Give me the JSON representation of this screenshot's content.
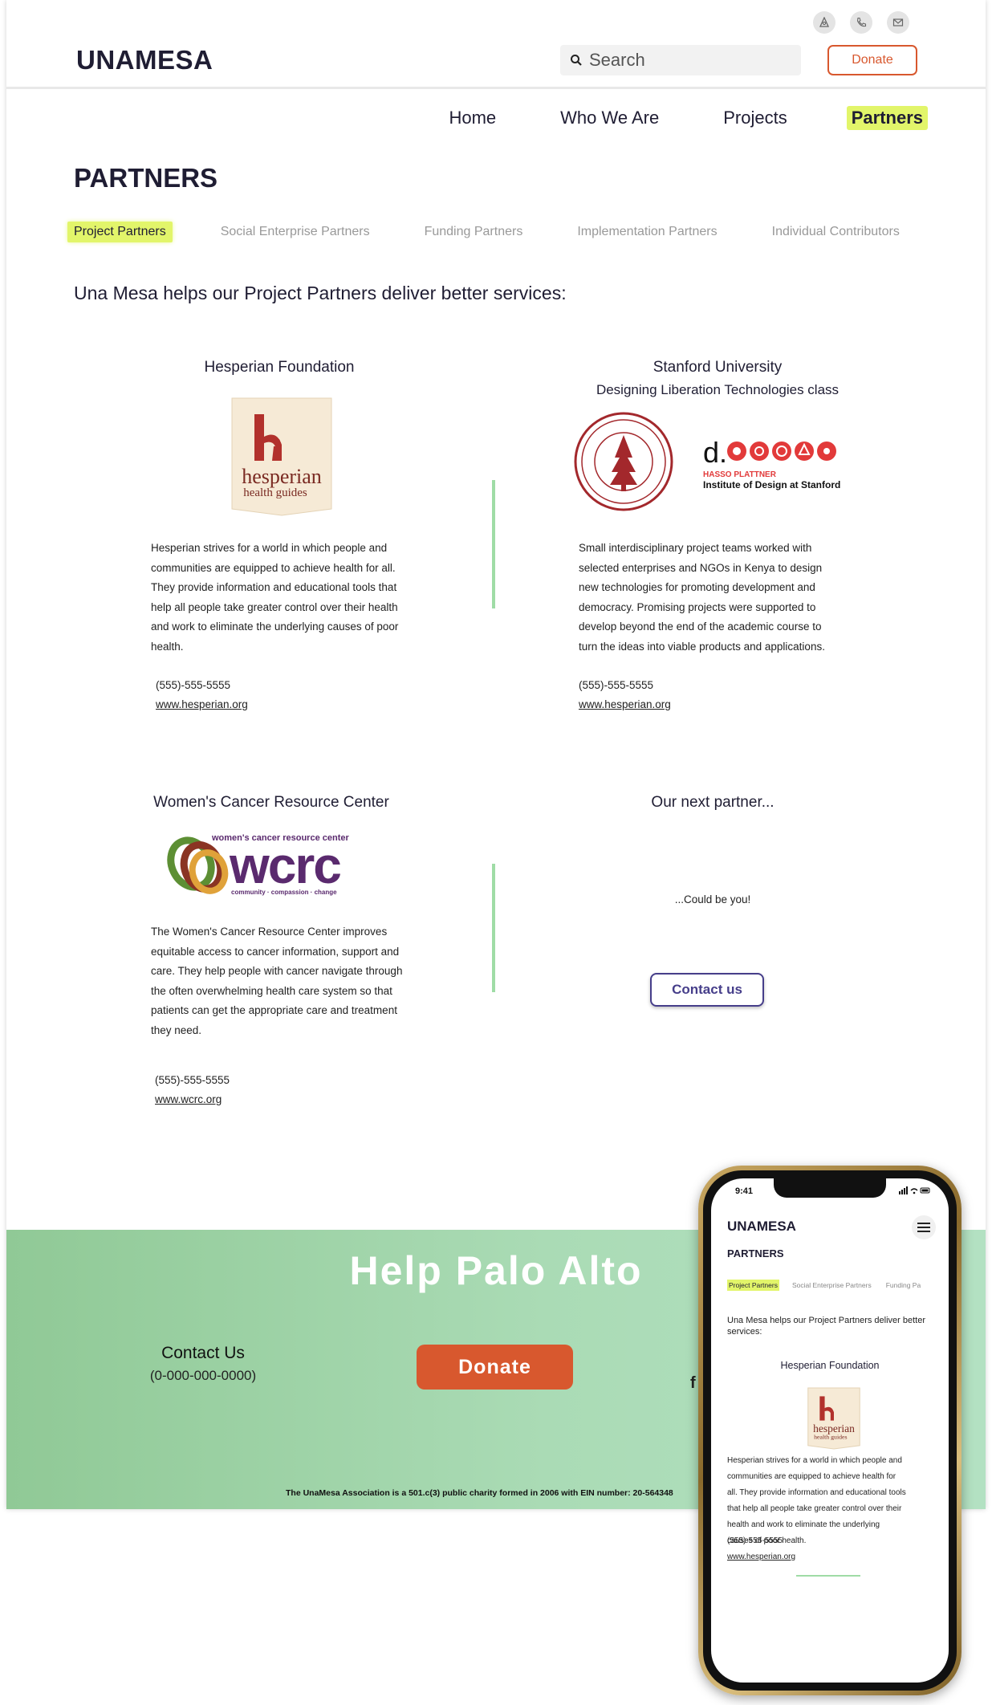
{
  "header": {
    "brand": "UNAMESA",
    "search_placeholder": "Search",
    "donate_label": "Donate",
    "icons": [
      "ambulance-icon",
      "phone-icon",
      "mail-icon"
    ]
  },
  "nav": {
    "items": [
      {
        "label": "Home"
      },
      {
        "label": "Who We Are"
      },
      {
        "label": "Projects"
      },
      {
        "label": "Partners"
      }
    ],
    "active": "Partners"
  },
  "page": {
    "title": "PARTNERS",
    "subtabs": [
      {
        "label": "Project Partners"
      },
      {
        "label": "Social Enterprise Partners"
      },
      {
        "label": "Funding Partners"
      },
      {
        "label": "Implementation Partners"
      },
      {
        "label": "Individual Contributors"
      }
    ],
    "intro": "Una Mesa helps our Project Partners deliver better services:"
  },
  "partners": [
    {
      "name": "Hesperian Foundation",
      "logo_text": [
        "hesperian",
        "health guides"
      ],
      "description": [
        "Hesperian strives for a world in which people and",
        "communities are equipped to achieve health for all.",
        "They provide information and educational tools that",
        "help all people take greater control over their health",
        "and work to eliminate the underlying causes of poor",
        "health."
      ],
      "phone": "(555)-555-5555",
      "url": "www.hesperian.org"
    },
    {
      "name": "Stanford University",
      "subtitle": "Designing Liberation Technologies class",
      "logo_text": [
        "d.",
        "HASSO PLATTNER",
        "Institute of Design at Stanford"
      ],
      "description": [
        "Small interdisciplinary project teams worked with",
        "selected enterprises and NGOs in Kenya to design",
        "new technologies for promoting development and",
        "democracy. Promising projects were supported to",
        "develop beyond the end of the academic course to",
        "turn the ideas into viable products and applications."
      ],
      "phone": "(555)-555-5555",
      "url": "www.hesperian.org"
    },
    {
      "name": "Women's Cancer Resource Center",
      "logo_text": [
        "women's cancer resource center",
        "wcrc",
        "community · compassion · change"
      ],
      "description": [
        "The Women's Cancer Resource Center improves",
        "equitable access to cancer information, support and",
        "care. They help people with cancer navigate through",
        "the often overwhelming health care system so that",
        "patients can get the appropriate care and treatment",
        "they need."
      ],
      "phone": "(555)-555-5555",
      "url": "www.wcrc.org"
    }
  ],
  "next_partner": {
    "title": "Our next partner...",
    "text": "...Could be you!",
    "button": "Contact us"
  },
  "footer": {
    "title": "Help Palo Alto",
    "contact_heading": "Contact Us",
    "contact_phone": "(0-000-000-0000)",
    "donate_label": "Donate",
    "social_icon": "f",
    "legal": "The UnaMesa Association is a 501.c(3) public charity formed in 2006 with EIN number: 20-564348"
  },
  "mobile": {
    "time": "9:41",
    "brand": "UNAMESA",
    "title": "PARTNERS",
    "tabs": [
      "Project Partners",
      "Social Enterprise Partners",
      "Funding Pa"
    ],
    "intro": "Una Mesa helps our Project Partners deliver better services:",
    "card_title": "Hesperian Foundation",
    "description": [
      "Hesperian strives for a world in which people and",
      "communities are equipped to achieve health for",
      "all. They provide information and educational tools",
      "that help all people take greater control over their",
      "health and work to eliminate the underlying",
      "causes of poor health."
    ],
    "phone": "(555)-555-5555",
    "url": "www.hesperian.org"
  },
  "colors": {
    "accent": "#e2f56a",
    "donate": "#d8582e",
    "brand_dark": "#1f1d33",
    "footer_green": "#90c996",
    "divider_green": "#9fdca6",
    "contact_purple": "#463e8a"
  }
}
